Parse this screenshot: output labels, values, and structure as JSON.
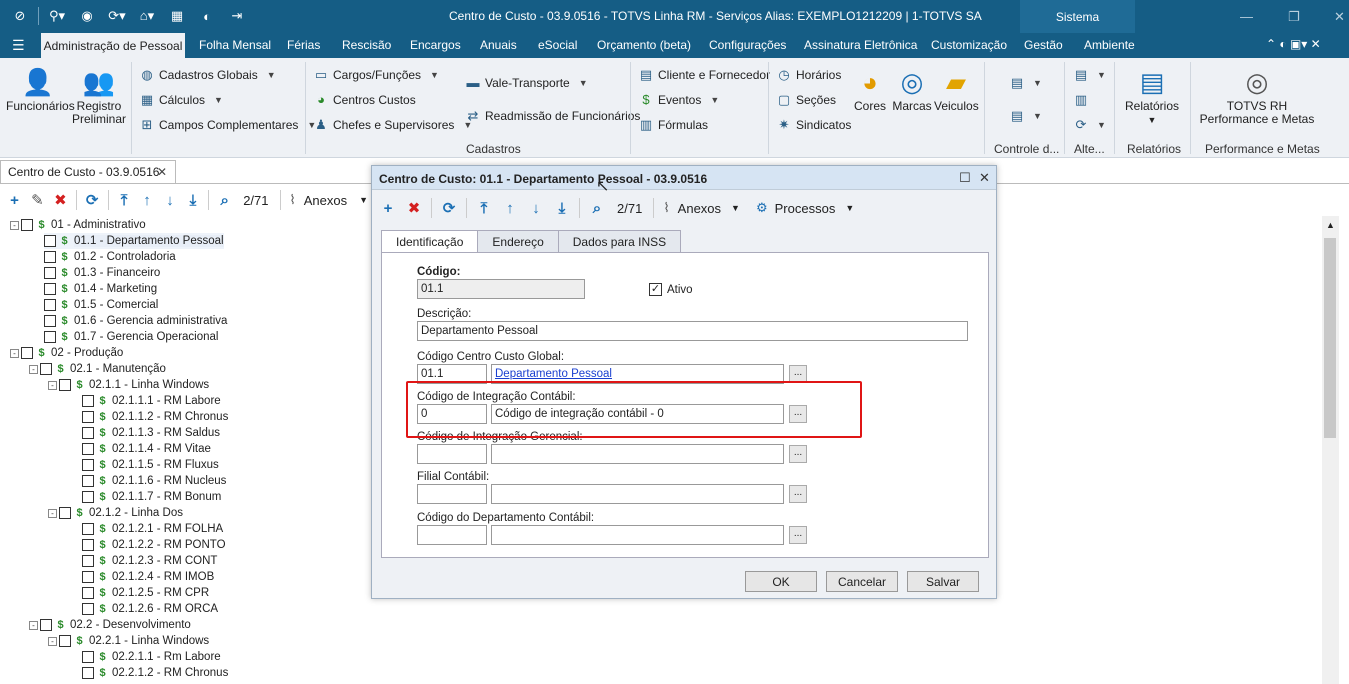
{
  "window": {
    "title": "Centro de Custo - 03.9.0516 - TOTVS Linha RM - Serviços  Alias: EXEMPLO1212209 | 1-TOTVS SA",
    "system": "Sistema"
  },
  "menu": [
    "Administração de Pessoal",
    "Folha Mensal",
    "Férias",
    "Rescisão",
    "Encargos",
    "Anuais",
    "eSocial",
    "Orçamento (beta)",
    "Configurações",
    "Assinatura Eletrônica",
    "Customização",
    "Gestão",
    "Ambiente"
  ],
  "ribbon": {
    "funcionarios": "Funcionários",
    "registro_1": "Registro",
    "registro_2": "Preliminar",
    "cadastros_globais": "Cadastros Globais",
    "calculos": "Cálculos",
    "campos_complementares": "Campos Complementares",
    "cargos": "Cargos/Funções",
    "centros_custos": "Centros Custos",
    "chefes": "Chefes e Supervisores",
    "vale_transporte": "Vale-Transporte",
    "readmissao": "Readmissão de Funcionários",
    "cliente_fornecedor": "Cliente e Fornecedor",
    "eventos": "Eventos",
    "formulas": "Fórmulas",
    "horarios": "Horários",
    "secoes": "Seções",
    "sindicatos": "Sindicatos",
    "cores": "Cores",
    "marcas": "Marcas",
    "veiculos": "Veiculos",
    "relatorios": "Relatórios",
    "totvs_rh_1": "TOTVS RH",
    "totvs_rh_2": "Performance e Metas",
    "grp_cadastros": "Cadastros",
    "grp_controle": "Controle d...",
    "grp_alte": "Alte...",
    "grp_relatorios": "Relatórios",
    "grp_perf": "Performance e Metas"
  },
  "doc_tab": "Centro de Custo - 03.9.0516",
  "toolbar": {
    "counter": "2/71",
    "anexos": "Anexos"
  },
  "tree": [
    {
      "label": "01 - Administrativo",
      "level": 0,
      "exp": "-"
    },
    {
      "label": "01.1 - Departamento Pessoal",
      "level": 1,
      "selected": true
    },
    {
      "label": "01.2 - Controladoria",
      "level": 1
    },
    {
      "label": "01.3 - Financeiro",
      "level": 1
    },
    {
      "label": "01.4 - Marketing",
      "level": 1
    },
    {
      "label": "01.5 - Comercial",
      "level": 1
    },
    {
      "label": "01.6 - Gerencia administrativa",
      "level": 1
    },
    {
      "label": "01.7 - Gerencia Operacional",
      "level": 1
    },
    {
      "label": "02 - Produção",
      "level": 0,
      "exp": "-"
    },
    {
      "label": "02.1 - Manutenção",
      "level": 1,
      "exp": "-"
    },
    {
      "label": "02.1.1 - Linha Windows",
      "level": 2,
      "exp": "-"
    },
    {
      "label": "02.1.1.1 - RM Labore",
      "level": 3
    },
    {
      "label": "02.1.1.2 - RM Chronus",
      "level": 3
    },
    {
      "label": "02.1.1.3 - RM Saldus",
      "level": 3
    },
    {
      "label": "02.1.1.4 - RM Vitae",
      "level": 3
    },
    {
      "label": "02.1.1.5 - RM Fluxus",
      "level": 3
    },
    {
      "label": "02.1.1.6 - RM Nucleus",
      "level": 3
    },
    {
      "label": "02.1.1.7 - RM Bonum",
      "level": 3
    },
    {
      "label": "02.1.2 - Linha Dos",
      "level": 2,
      "exp": "-"
    },
    {
      "label": "02.1.2.1 - RM FOLHA",
      "level": 3
    },
    {
      "label": "02.1.2.2 - RM PONTO",
      "level": 3
    },
    {
      "label": "02.1.2.3 - RM CONT",
      "level": 3
    },
    {
      "label": "02.1.2.4 - RM IMOB",
      "level": 3
    },
    {
      "label": "02.1.2.5 - RM CPR",
      "level": 3
    },
    {
      "label": "02.1.2.6 - RM ORCA",
      "level": 3
    },
    {
      "label": "02.2 - Desenvolvimento",
      "level": 1,
      "exp": "-"
    },
    {
      "label": "02.2.1 - Linha Windows",
      "level": 2,
      "exp": "-"
    },
    {
      "label": "02.2.1.1 - Rm Labore",
      "level": 3
    },
    {
      "label": "02.2.1.2 - RM Chronus",
      "level": 3
    }
  ],
  "dialog": {
    "title": "Centro de Custo: 01.1 - Departamento Pessoal - 03.9.0516",
    "counter": "2/71",
    "anexos": "Anexos",
    "processos": "Processos",
    "tabs": [
      "Identificação",
      "Endereço",
      "Dados para INSS"
    ],
    "codigo_label": "Código:",
    "codigo_value": "01.1",
    "ativo_label": "Ativo",
    "descricao_label": "Descrição:",
    "descricao_value": "Departamento Pessoal",
    "ccg_label": "Código Centro Custo Global:",
    "ccg_code": "01.1",
    "ccg_desc": "Departamento Pessoal",
    "cic_label": "Código de Integração Contábil:",
    "cic_code": "0",
    "cic_desc": "Código de integração contábil - 0",
    "cig_label": "Código de Integração Gerencial:",
    "filial_label": "Filial Contábil:",
    "depto_label": "Código do Departamento Contábil:",
    "ok": "OK",
    "cancelar": "Cancelar",
    "salvar": "Salvar"
  }
}
